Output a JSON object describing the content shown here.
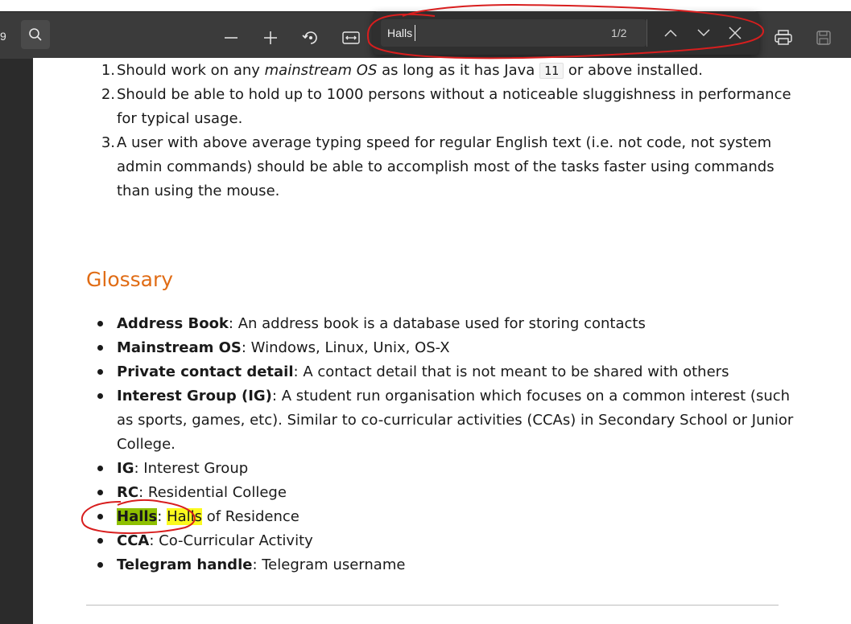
{
  "toolbar": {
    "page_number_fragment": "9",
    "icons": [
      "search-icon",
      "zoom-out-icon",
      "zoom-in-icon",
      "rotate-icon",
      "fit-width-icon",
      "print-icon",
      "save-icon"
    ]
  },
  "find": {
    "query": "Halls",
    "count": "1/2",
    "icons": [
      "chevron-up-icon",
      "chevron-down-icon",
      "close-icon"
    ]
  },
  "document": {
    "numbered": [
      {
        "num": "1.",
        "parts": {
          "a": "Should work on any ",
          "b": "mainstream OS",
          "c": " as long as it has Java ",
          "code": "11",
          "d": " or above installed."
        }
      },
      {
        "num": "2.",
        "line1": "Should be able to hold up to 1000 persons without a noticeable sluggishness in performance",
        "line2": "for typical usage."
      },
      {
        "num": "3.",
        "line1": "A user with above average typing speed for regular English text (i.e. not code, not system",
        "line2": "admin commands) should be able to accomplish most of the tasks faster using commands",
        "line3": "than using the mouse."
      }
    ],
    "glossary_heading": "Glossary",
    "glossary": [
      {
        "term": "Address Book",
        "def": ": An address book is a database used for storing contacts"
      },
      {
        "term": "Mainstream OS",
        "def": ": Windows, Linux, Unix, OS-X"
      },
      {
        "term": "Private contact detail",
        "def": ": A contact detail that is not meant to be shared with others"
      },
      {
        "term": "Interest Group (IG)",
        "def": ": A student run organisation which focuses on a common interest (such",
        "def2": "as sports, games, etc). Similar to co-curricular activities (CCAs) in Secondary School or Junior",
        "def3": "College."
      },
      {
        "term": "IG",
        "def": ": Interest Group"
      },
      {
        "term": "RC",
        "def": ": Residential College"
      },
      {
        "term": "Halls",
        "sep": ": ",
        "match": "Halls",
        "def": " of Residence"
      },
      {
        "term": "CCA",
        "def": ": Co-Curricular Activity"
      },
      {
        "term": "Telegram handle",
        "def": ": Telegram username"
      }
    ]
  },
  "colors": {
    "heading": "#e06c15",
    "current_match": "#8ec000",
    "match": "#fbfa1e",
    "annotation": "#d81e1e"
  }
}
